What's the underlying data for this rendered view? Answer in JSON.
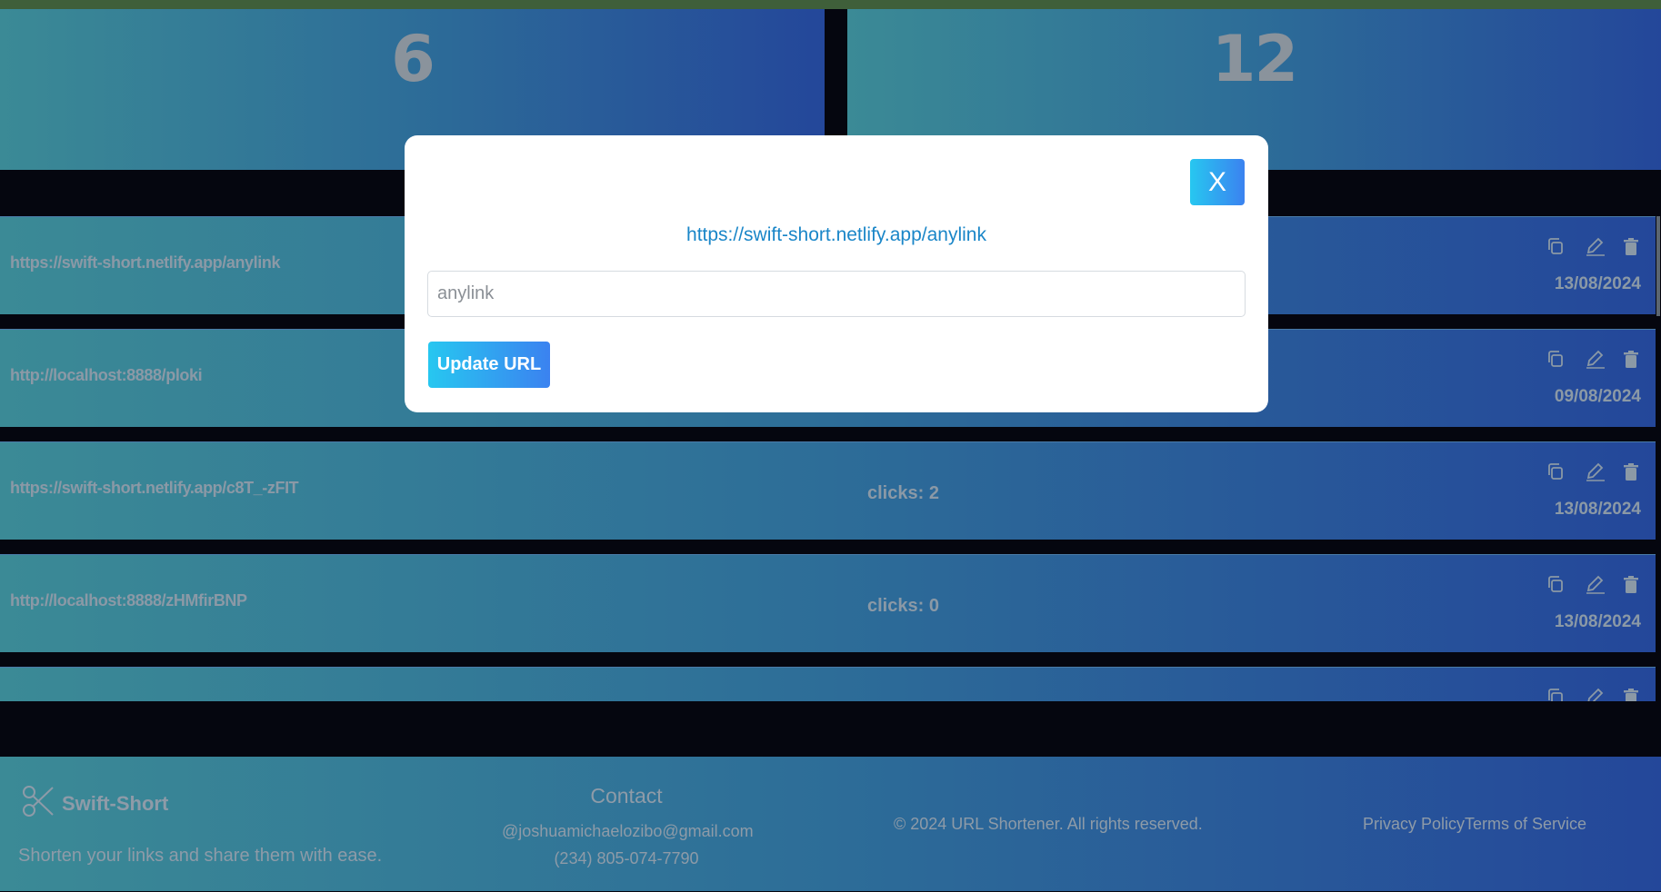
{
  "stats": {
    "first": "6",
    "second": "12"
  },
  "links": [
    {
      "url": "https://swift-short.netlify.app/anylink",
      "clicks": "",
      "date": "13/08/2024"
    },
    {
      "url": "http://localhost:8888/ploki",
      "clicks": "",
      "date": "09/08/2024"
    },
    {
      "url": "https://swift-short.netlify.app/c8T_-zFIT",
      "clicks": "clicks: 2",
      "date": "13/08/2024"
    },
    {
      "url": "http://localhost:8888/zHMfirBNP",
      "clicks": "clicks: 0",
      "date": "13/08/2024"
    }
  ],
  "icons": {
    "copy": "copy-icon",
    "edit": "pencil-icon",
    "delete": "trash-icon",
    "logo": "scissors-icon"
  },
  "modal": {
    "close_label": "X",
    "link": "https://swift-short.netlify.app/anylink",
    "input_placeholder": "anylink",
    "update_label": "Update URL"
  },
  "footer": {
    "brand": "Swift-Short",
    "tagline": "Shorten your links and share them with ease.",
    "contact_title": "Contact",
    "email": "@joshuamichaelozibo@gmail.com",
    "phone": "(234) 805-074-7790",
    "copyright": "© 2024 URL Shortener. All rights reserved.",
    "privacy": "Privacy Policy",
    "terms": "Terms of Service"
  },
  "colors": {
    "accent_start": "#27c7f0",
    "accent_end": "#3b82f0",
    "page_bg": "#05060f",
    "card_gradient_start": "#3b8a96",
    "card_gradient_end": "#24479a"
  }
}
